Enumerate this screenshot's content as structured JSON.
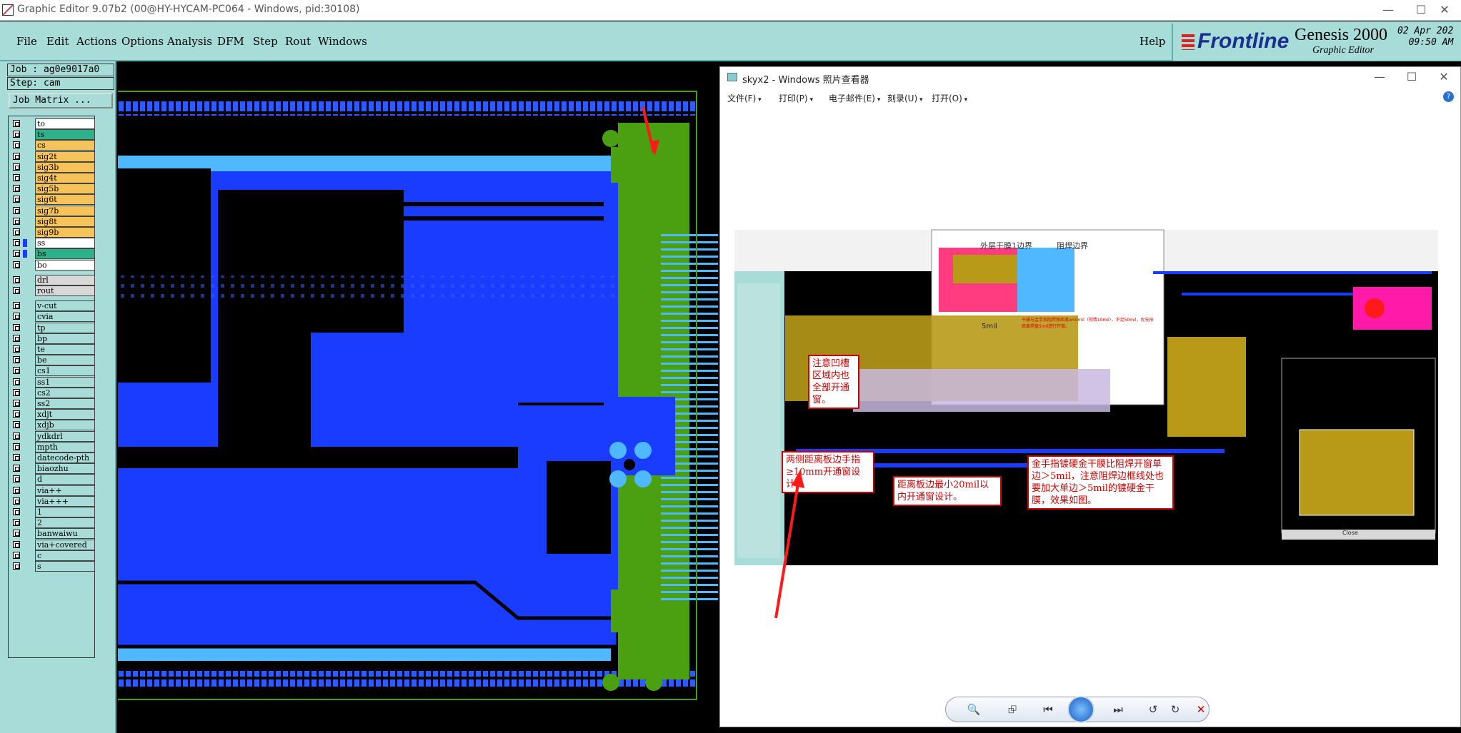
{
  "titlebar": {
    "title": "Graphic Editor 9.07b2 (00@HY-HYCAM-PC064 - Windows, pid:30108)",
    "min": "—",
    "max": "☐",
    "close": "✕"
  },
  "menu": {
    "file": "File",
    "edit": "Edit",
    "actions": "Actions",
    "options": "Options",
    "analysis": "Analysis",
    "dfm": "DFM",
    "step": "Step",
    "rout": "Rout",
    "windows": "Windows",
    "help": "Help"
  },
  "brand": {
    "logo": "Frontline",
    "product": "Genesis 2000",
    "subtitle": "Graphic Editor",
    "date": "02 Apr 202",
    "time": "09:50 AM"
  },
  "job": {
    "job_label": "Job : ag0e9017a0",
    "step_label": "Step: cam",
    "matrix_button": "Job Matrix ..."
  },
  "layers": [
    {
      "name": "to",
      "color": "#ffffff"
    },
    {
      "name": "ts",
      "color": "#2eb08a"
    },
    {
      "name": "cs",
      "color": "#f6c35a"
    },
    {
      "name": "sig2t",
      "color": "#f6c35a"
    },
    {
      "name": "sig3b",
      "color": "#f6c35a"
    },
    {
      "name": "sig4t",
      "color": "#f6c35a"
    },
    {
      "name": "sig5b",
      "color": "#f6c35a"
    },
    {
      "name": "sig6t",
      "color": "#f6c35a"
    },
    {
      "name": "sig7b",
      "color": "#f6c35a"
    },
    {
      "name": "sig8t",
      "color": "#f6c35a"
    },
    {
      "name": "sig9b",
      "color": "#f6c35a"
    },
    {
      "name": "ss",
      "color": "#ffffff"
    },
    {
      "name": "bs",
      "color": "#2eb08a"
    },
    {
      "name": "bo",
      "color": "#ffffff"
    },
    {
      "name": "drl",
      "color": "#d8d8d8"
    },
    {
      "name": "rout",
      "color": "#d8d8d8"
    },
    {
      "name": "v-cut",
      "color": "#a8dcd9"
    },
    {
      "name": "cvia",
      "color": "#a8dcd9"
    },
    {
      "name": "tp",
      "color": "#a8dcd9"
    },
    {
      "name": "bp",
      "color": "#a8dcd9"
    },
    {
      "name": "te",
      "color": "#a8dcd9"
    },
    {
      "name": "be",
      "color": "#a8dcd9"
    },
    {
      "name": "cs1",
      "color": "#a8dcd9"
    },
    {
      "name": "ss1",
      "color": "#a8dcd9"
    },
    {
      "name": "cs2",
      "color": "#a8dcd9"
    },
    {
      "name": "ss2",
      "color": "#a8dcd9"
    },
    {
      "name": "xdjt",
      "color": "#a8dcd9"
    },
    {
      "name": "xdjb",
      "color": "#a8dcd9"
    },
    {
      "name": "ydkdrl",
      "color": "#a8dcd9"
    },
    {
      "name": "mpth",
      "color": "#a8dcd9"
    },
    {
      "name": "datecode-pth",
      "color": "#a8dcd9"
    },
    {
      "name": "biaozhu",
      "color": "#a8dcd9"
    },
    {
      "name": "d",
      "color": "#a8dcd9"
    },
    {
      "name": "via++",
      "color": "#a8dcd9"
    },
    {
      "name": "via+++",
      "color": "#a8dcd9"
    },
    {
      "name": "1",
      "color": "#a8dcd9"
    },
    {
      "name": "2",
      "color": "#a8dcd9"
    },
    {
      "name": "banwaiwu",
      "color": "#a8dcd9"
    },
    {
      "name": "via+covered",
      "color": "#a8dcd9"
    },
    {
      "name": "c",
      "color": "#a8dcd9"
    },
    {
      "name": "s",
      "color": "#a8dcd9"
    }
  ],
  "viewer": {
    "title": "skyx2 - Windows 照片查看器",
    "menu": {
      "file": "文件(F)",
      "print": "打印(P)",
      "email": "电子邮件(E)",
      "burn": "刻录(U)",
      "open": "打开(O)"
    },
    "annotations": {
      "a1": "注意凹槽区域内也全部开通窗。",
      "a2": "两侧距离板边手指≥10mm开通窗设计。",
      "a3": "距离板边最小20mil以内开通窗设计。",
      "a4": "金手指镀硬金干膜比阻焊开窗单边＞5mil，注意阻焊边框线处也要加大单边＞5mil的镀硬金干膜，效果如图。",
      "outer_line": "外层干膜1边界",
      "mask_line": "阻焊边界",
      "dim_5mil": "5mil",
      "note_red": "干膜与金手指阻焊移距离≥50mil（视情10mil），不足50mil，优先按距离焊盘5mil进行开窗。",
      "close": "Close"
    }
  }
}
